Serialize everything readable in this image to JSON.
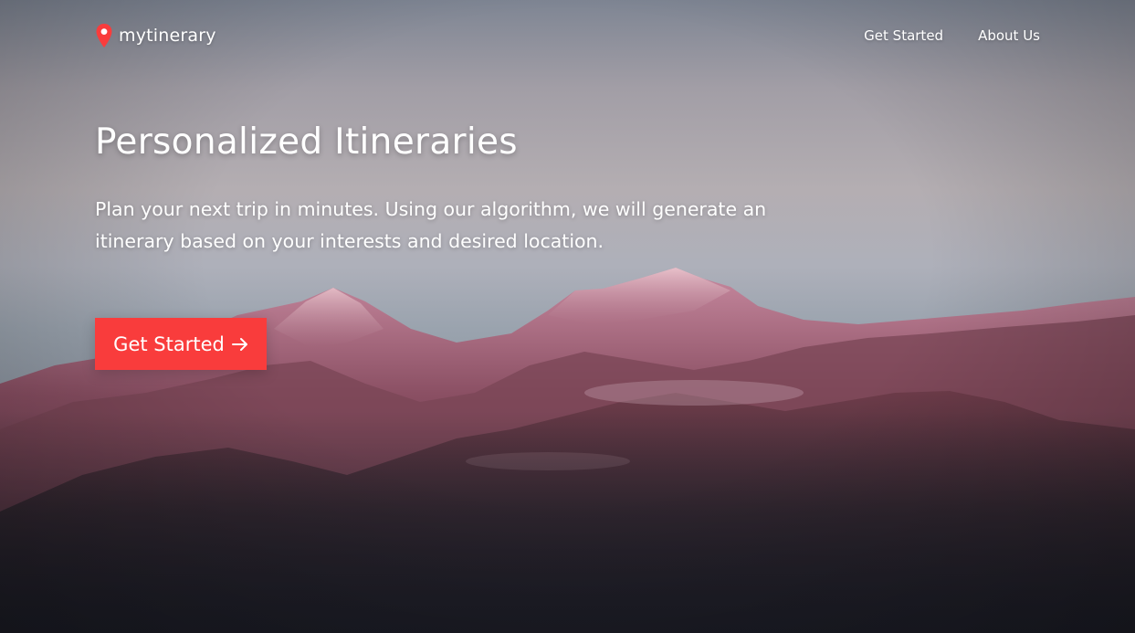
{
  "brand": {
    "name": "mytinerary",
    "icon": "map-pin-icon",
    "icon_color": "#f93c3c"
  },
  "nav": {
    "links": [
      {
        "label": "Get Started"
      },
      {
        "label": "About Us"
      }
    ]
  },
  "hero": {
    "headline": "Personalized Itineraries",
    "subheadline": "Plan your next trip in minutes. Using our algorithm, we will generate an itinerary based on your interests and desired location.",
    "cta_label": "Get Started",
    "cta_icon": "arrow-right-icon",
    "cta_color": "#f93c3c",
    "background": "mountain-range-photo"
  }
}
